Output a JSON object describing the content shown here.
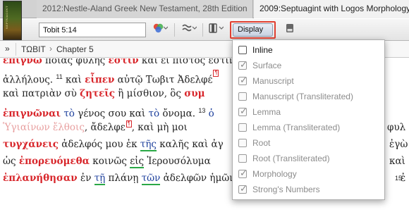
{
  "tabs": [
    {
      "label": "2012:Nestle-Aland Greek New Testament, 28th Edition",
      "active": false
    },
    {
      "label": "2009:Septuagint with Logos Morphology",
      "active": true
    }
  ],
  "cover": {
    "text": "SEPTUAGINT"
  },
  "toolbar": {
    "reference_value": "Tobit 5:14",
    "display_label": "Display"
  },
  "breadcrumb": {
    "expander": "»",
    "book": "ΤΩΒΙΤ",
    "chevron": "›",
    "chapter": "Chapter 5"
  },
  "text_lines": [
    [
      "ἐπίγνω",
      " ποίας φυλῆς ",
      "ἐστιν",
      " καὶ εἰ πιστὸς ἐστιν"
    ],
    [
      "ἀλλήλους. ",
      "11",
      " καὶ ",
      "εἶπεν",
      " αὐτῷ Τωβιτ Ἀδελφέ"
    ],
    [
      "καὶ πατριὰν σὺ ",
      "ζητεῖς",
      " ἢ μίσθιον, ὃς ",
      "συμ"
    ],
    [
      "ἐπιγνῶναι",
      " ",
      "τὸ",
      " γένος σου καὶ ",
      "τὸ",
      " ὄνομα. ",
      "13",
      " ὁ"
    ],
    [
      "Ὑγιαίνων",
      " ἔλθοις",
      ", ἄδελφε",
      ", καὶ μὴ μοι",
      "φυλ"
    ],
    [
      "τυγχάνεις",
      " ἀδελφός μου ἐκ ",
      "τῆς",
      " καλῆς καὶ ἀγ",
      "ἐγὼ"
    ],
    [
      "ὡς ",
      "ἐπορευόμεθα",
      " κοινῶς ",
      "εἰς",
      " Ἰερουσόλυμα",
      "καὶ"
    ],
    [
      "ἐπλανήθησαν",
      " ἐν ",
      "τῇ",
      " πλάνῃ ",
      "τῶν",
      " ἀδελφῶν ἡμῶν",
      "15",
      " ἐ"
    ]
  ],
  "display_options": [
    {
      "label": "Inline",
      "checked": false,
      "enabled": true
    },
    {
      "label": "Surface",
      "checked": true,
      "enabled": false
    },
    {
      "label": "Manuscript",
      "checked": true,
      "enabled": false
    },
    {
      "label": "Manuscript (Transliterated)",
      "checked": false,
      "enabled": false
    },
    {
      "label": "Lemma",
      "checked": true,
      "enabled": false
    },
    {
      "label": "Lemma (Transliterated)",
      "checked": false,
      "enabled": false
    },
    {
      "label": "Root",
      "checked": false,
      "enabled": false
    },
    {
      "label": "Root (Transliterated)",
      "checked": false,
      "enabled": false
    },
    {
      "label": "Morphology",
      "checked": true,
      "enabled": false
    },
    {
      "label": "Strong's Numbers",
      "checked": true,
      "enabled": false
    }
  ],
  "colors": {
    "accent_red": "#d8262b",
    "highlight_outline": "#e03f31",
    "underline_green": "#2aa846",
    "article_blue": "#1d3f9c"
  },
  "icons": [
    "color-picker-icon",
    "interlinear-icon",
    "columns-icon",
    "sidebar-panel-icon",
    "expand-icon",
    "chevron-right-icon",
    "caret-down-icon",
    "checkmark-icon",
    "note-marker-icon"
  ]
}
